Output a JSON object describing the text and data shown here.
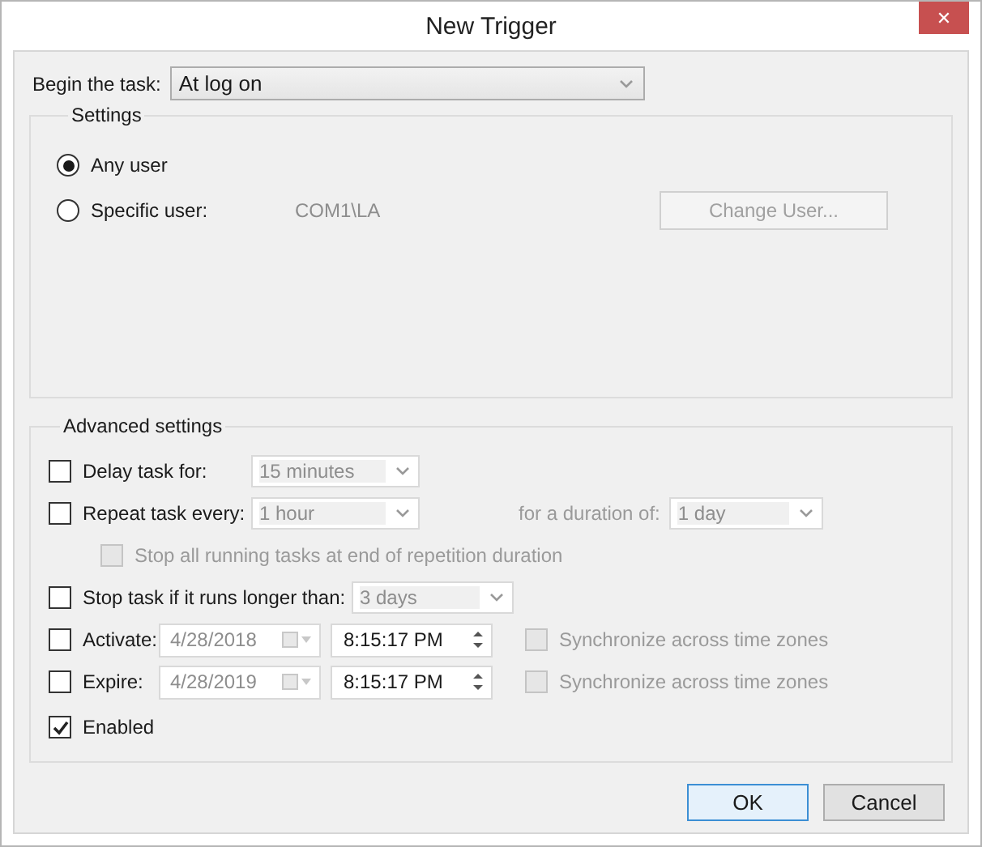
{
  "window": {
    "title": "New Trigger",
    "close": "✕"
  },
  "begin_task": {
    "label": "Begin the task:",
    "value": "At log on"
  },
  "settings": {
    "title": "Settings",
    "users": [
      {
        "label": "Any user",
        "selected": true
      },
      {
        "label": "Specific user:",
        "selected": false
      }
    ],
    "user_name": "COM1\\LA",
    "change_user_button": {
      "label": "Change User...",
      "disabled": true
    }
  },
  "advanced": {
    "title": "Advanced settings",
    "delay": {
      "label": "Delay task for:",
      "checked": false,
      "value": "15 minutes",
      "disabled": true
    },
    "repeat": {
      "label": "Repeat task every:",
      "checked": false,
      "value": "1 hour",
      "disabled": true,
      "duration_label": "for a duration of:",
      "duration_value": "1 day"
    },
    "stop_all": {
      "label": "Stop all running tasks at end of repetition duration",
      "checked": false,
      "disabled": true
    },
    "stop_long": {
      "label": "Stop task if it runs longer than:",
      "checked": false,
      "value": "3 days",
      "disabled": true
    },
    "dates": [
      {
        "label": "Activate:",
        "checked": false,
        "date": "4/28/2018",
        "time": "8:15:17 PM",
        "sync_label": "Synchronize across time zones",
        "sync_checked": false,
        "disabled": true
      },
      {
        "label": "Expire:",
        "checked": false,
        "date": "4/28/2019",
        "time": "8:15:17 PM",
        "sync_label": "Synchronize across time zones",
        "sync_checked": false,
        "disabled": true
      }
    ],
    "enabled": {
      "label": "Enabled",
      "checked": true
    }
  },
  "buttons": [
    {
      "label": "OK",
      "default": true
    },
    {
      "label": "Cancel",
      "default": false
    }
  ]
}
